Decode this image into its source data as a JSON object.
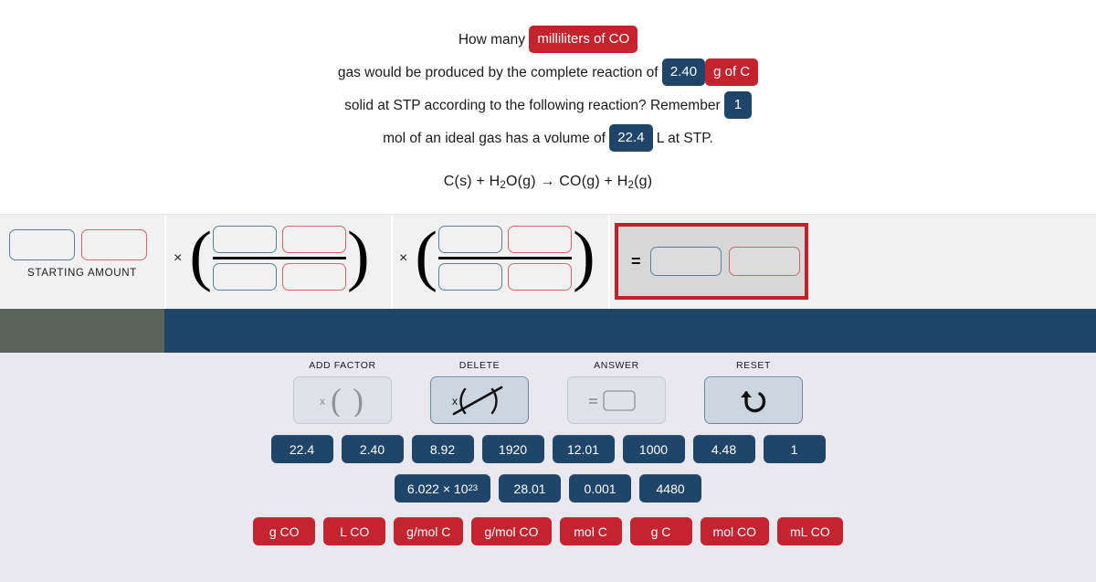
{
  "question": {
    "segments": [
      {
        "type": "text",
        "value": "How many "
      },
      {
        "type": "chip",
        "style": "red",
        "value": "milliliters of CO"
      },
      {
        "type": "text",
        "value": " gas would be produced by the complete reaction of "
      },
      {
        "type": "chip",
        "style": "blue",
        "value": "2.40"
      },
      {
        "type": "chip",
        "style": "red",
        "value": "g of C"
      },
      {
        "type": "text",
        "value": " solid at STP according to the following reaction? Remember "
      },
      {
        "type": "chip",
        "style": "blue",
        "value": "1"
      },
      {
        "type": "text",
        "value": " mol of an ideal gas has a volume of "
      },
      {
        "type": "chip",
        "style": "blue",
        "value": "22.4"
      },
      {
        "type": "text",
        "value": " L at STP."
      }
    ],
    "line1_a": "How many ",
    "chip_milliliters_co": "milliliters of CO",
    "line1_b": " gas would be produced by the complete reaction of ",
    "chip_240": "2.40",
    "chip_g_of_c": "g of C",
    "line2_b": " solid at STP according to the following reaction? Remember ",
    "chip_1": "1",
    "line2_c": " mol of an ",
    "line3_a": "ideal gas has a volume of ",
    "chip_224": "22.4",
    "line3_b": " L at STP."
  },
  "equation": {
    "full": "C(s) + H2O(g) → CO(g) + H2(g)",
    "p1": "C(s) + H",
    "sub1": "2",
    "p2": "O(g) ",
    "arrow": "→",
    "p3": " CO(g) + H",
    "sub2": "2",
    "p4": "(g)"
  },
  "workspace": {
    "starting_amount_label": "STARTING AMOUNT",
    "multiply_symbol": "×",
    "equals_symbol": "=",
    "starting_amount_value_placeholder": "",
    "starting_amount_unit_placeholder": "",
    "factor1": {
      "numerator_value": "",
      "numerator_unit": "",
      "denominator_value": "",
      "denominator_unit": ""
    },
    "factor2": {
      "numerator_value": "",
      "numerator_unit": "",
      "denominator_value": "",
      "denominator_unit": ""
    },
    "answer": {
      "value": "",
      "unit": "",
      "highlighted": true,
      "highlight_color": "#c0202a"
    }
  },
  "color_bar": {
    "left_color": "#59635a",
    "right_color": "#1f4568"
  },
  "tools": [
    {
      "label": "ADD FACTOR",
      "icon": "add-factor-icon",
      "enabled": false
    },
    {
      "label": "DELETE",
      "icon": "delete-factor-icon",
      "enabled": true
    },
    {
      "label": "ANSWER",
      "icon": "answer-icon",
      "enabled": false
    },
    {
      "label": "RESET",
      "icon": "reset-undo-icon",
      "enabled": true
    }
  ],
  "tiles": {
    "numbers_row1": [
      "22.4",
      "2.40",
      "8.92",
      "1920",
      "12.01",
      "1000",
      "4.48",
      "1"
    ],
    "numbers_row2_avogadro_base": "6.022 × 10",
    "numbers_row2_avogadro_exp": "23",
    "numbers_row2_rest": [
      "28.01",
      "0.001",
      "4480"
    ],
    "units": [
      "g CO",
      "L CO",
      "g/mol C",
      "g/mol CO",
      "mol C",
      "g C",
      "mol CO",
      "mL CO"
    ],
    "navy_color": "#1f4568",
    "red_color": "#c42430"
  }
}
